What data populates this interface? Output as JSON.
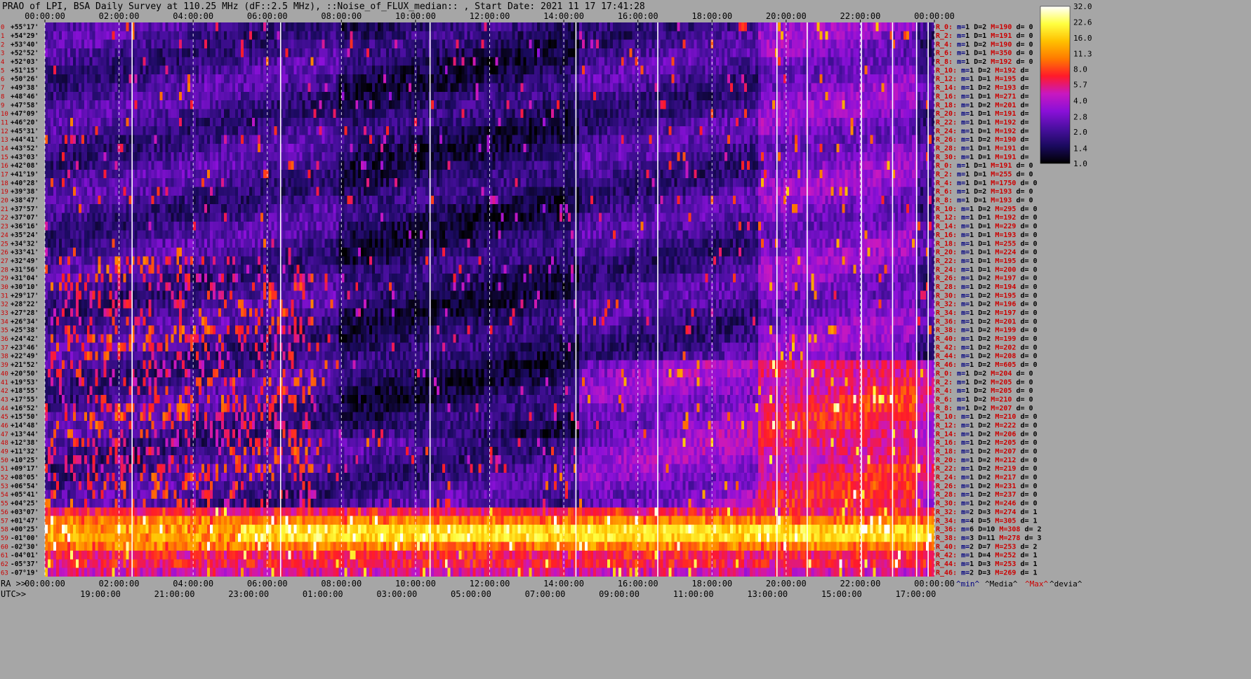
{
  "chart_data": {
    "type": "heatmap",
    "title": "PRAO of LPI, BSA Daily Survey at 110.25 MHz (dF::2.5 MHz), ::Noise_of_FLUX_median:: , Start Date: 2021 11 17 17:41:28",
    "top_ticks": [
      "00:00:00",
      "02:00:00",
      "04:00:00",
      "06:00:00",
      "08:00:00",
      "10:00:00",
      "12:00:00",
      "14:00:00",
      "16:00:00",
      "18:00:00",
      "20:00:00",
      "22:00:00",
      "00:00:00"
    ],
    "ra_label": "RA >>",
    "ra_ticks": [
      "00:00:00",
      "02:00:00",
      "04:00:00",
      "06:00:00",
      "08:00:00",
      "10:00:00",
      "12:00:00",
      "14:00:00",
      "16:00:00",
      "18:00:00",
      "20:00:00",
      "22:00:00",
      "00:00:00"
    ],
    "utc_label": "UTC>>",
    "utc_ticks": [
      "19:00:00",
      "21:00:00",
      "23:00:00",
      "01:00:00",
      "03:00:00",
      "05:00:00",
      "07:00:00",
      "09:00:00",
      "11:00:00",
      "13:00:00",
      "15:00:00",
      "17:00:00"
    ],
    "declinations": [
      "+55°17'",
      "+54°29'",
      "+53°40'",
      "+52°52'",
      "+52°03'",
      "+51°15'",
      "+50°26'",
      "+49°38'",
      "+48°46'",
      "+47°58'",
      "+47°09'",
      "+46°20'",
      "+45°31'",
      "+44°41'",
      "+43°52'",
      "+43°03'",
      "+42°08'",
      "+41°19'",
      "+40°28'",
      "+39°38'",
      "+38°47'",
      "+37°57'",
      "+37°07'",
      "+36°16'",
      "+35°24'",
      "+34°32'",
      "+33°41'",
      "+32°49'",
      "+31°56'",
      "+31°04'",
      "+30°10'",
      "+29°17'",
      "+28°22'",
      "+27°28'",
      "+26°34'",
      "+25°38'",
      "+24°42'",
      "+23°46'",
      "+22°49'",
      "+21°52'",
      "+20°50'",
      "+19°53'",
      "+18°55'",
      "+17°55'",
      "+16°52'",
      "+15°50'",
      "+14°48'",
      "+13°44'",
      "+12°38'",
      "+11°32'",
      "+10°25'",
      "+09°17'",
      "+08°05'",
      "+06°54'",
      "+05°41'",
      "+04°25'",
      "+03°07'",
      "+01°47'",
      "+00°25'",
      "-01°00'",
      "-02°30'",
      "-04°01'",
      "-05°37'",
      "-07°19'"
    ],
    "colorbar_ticks": [
      "32.0",
      "22.6",
      "16.0",
      "11.3",
      "8.0",
      "5.7",
      "4.0",
      "2.8",
      "2.0",
      "1.4",
      "1.0"
    ],
    "colorbar_range": [
      1.0,
      32.0
    ],
    "colorbar_scale": "log",
    "colormap": [
      "#000000",
      "#1a0a5e",
      "#4a0fa0",
      "#8a10d8",
      "#c818c0",
      "#ff1a2a",
      "#ff7a00",
      "#ffc000",
      "#ffff40",
      "#ffffff"
    ],
    "rows": [
      {
        "r": "R_0:",
        "m": "1",
        "d": "2",
        "M": "190",
        "dev": "0"
      },
      {
        "r": "R_2:",
        "m": "1",
        "d": "1",
        "M": "191",
        "dev": "0"
      },
      {
        "r": "R_4:",
        "m": "1",
        "d": "2",
        "M": "190",
        "dev": "0"
      },
      {
        "r": "R_6:",
        "m": "1",
        "d": "1",
        "M": "350",
        "dev": "0"
      },
      {
        "r": "R_8:",
        "m": "1",
        "d": "2",
        "M": "192",
        "dev": "0"
      },
      {
        "r": "R_10:",
        "m": "1",
        "d": "2",
        "M": "192",
        "dev": ""
      },
      {
        "r": "R_12:",
        "m": "1",
        "d": "1",
        "M": "195",
        "dev": ""
      },
      {
        "r": "R_14:",
        "m": "1",
        "d": "2",
        "M": "193",
        "dev": ""
      },
      {
        "r": "R_16:",
        "m": "1",
        "d": "1",
        "M": "271",
        "dev": ""
      },
      {
        "r": "R_18:",
        "m": "1",
        "d": "2",
        "M": "201",
        "dev": ""
      },
      {
        "r": "R_20:",
        "m": "1",
        "d": "1",
        "M": "191",
        "dev": ""
      },
      {
        "r": "R_22:",
        "m": "1",
        "d": "1",
        "M": "192",
        "dev": ""
      },
      {
        "r": "R_24:",
        "m": "1",
        "d": "1",
        "M": "192",
        "dev": ""
      },
      {
        "r": "R_26:",
        "m": "1",
        "d": "2",
        "M": "190",
        "dev": ""
      },
      {
        "r": "R_28:",
        "m": "1",
        "d": "1",
        "M": "191",
        "dev": ""
      },
      {
        "r": "R_30:",
        "m": "1",
        "d": "1",
        "M": "191",
        "dev": ""
      },
      {
        "r": "R_0:",
        "m": "1",
        "d": "1",
        "M": "191",
        "dev": "0"
      },
      {
        "r": "R_2:",
        "m": "1",
        "d": "1",
        "M": "255",
        "dev": "0"
      },
      {
        "r": "R_4:",
        "m": "1",
        "d": "1",
        "M": "1750",
        "dev": "0"
      },
      {
        "r": "R_6:",
        "m": "1",
        "d": "2",
        "M": "193",
        "dev": "0"
      },
      {
        "r": "R_8:",
        "m": "1",
        "d": "1",
        "M": "193",
        "dev": "0"
      },
      {
        "r": "R_10:",
        "m": "1",
        "d": "2",
        "M": "295",
        "dev": "0"
      },
      {
        "r": "R_12:",
        "m": "1",
        "d": "1",
        "M": "192",
        "dev": "0"
      },
      {
        "r": "R_14:",
        "m": "1",
        "d": "1",
        "M": "229",
        "dev": "0"
      },
      {
        "r": "R_16:",
        "m": "1",
        "d": "1",
        "M": "193",
        "dev": "0"
      },
      {
        "r": "R_18:",
        "m": "1",
        "d": "1",
        "M": "255",
        "dev": "0"
      },
      {
        "r": "R_20:",
        "m": "1",
        "d": "1",
        "M": "224",
        "dev": "0"
      },
      {
        "r": "R_22:",
        "m": "1",
        "d": "1",
        "M": "195",
        "dev": "0"
      },
      {
        "r": "R_24:",
        "m": "1",
        "d": "1",
        "M": "200",
        "dev": "0"
      },
      {
        "r": "R_26:",
        "m": "1",
        "d": "2",
        "M": "197",
        "dev": "0"
      },
      {
        "r": "R_28:",
        "m": "1",
        "d": "2",
        "M": "194",
        "dev": "0"
      },
      {
        "r": "R_30:",
        "m": "1",
        "d": "2",
        "M": "195",
        "dev": "0"
      },
      {
        "r": "R_32:",
        "m": "1",
        "d": "2",
        "M": "196",
        "dev": "0"
      },
      {
        "r": "R_34:",
        "m": "1",
        "d": "2",
        "M": "197",
        "dev": "0"
      },
      {
        "r": "R_36:",
        "m": "1",
        "d": "2",
        "M": "201",
        "dev": "0"
      },
      {
        "r": "R_38:",
        "m": "1",
        "d": "2",
        "M": "199",
        "dev": "0"
      },
      {
        "r": "R_40:",
        "m": "1",
        "d": "2",
        "M": "199",
        "dev": "0"
      },
      {
        "r": "R_42:",
        "m": "1",
        "d": "2",
        "M": "202",
        "dev": "0"
      },
      {
        "r": "R_44:",
        "m": "1",
        "d": "2",
        "M": "208",
        "dev": "0"
      },
      {
        "r": "R_46:",
        "m": "1",
        "d": "2",
        "M": "605",
        "dev": "0"
      },
      {
        "r": "R_0:",
        "m": "1",
        "d": "2",
        "M": "204",
        "dev": "0"
      },
      {
        "r": "R_2:",
        "m": "1",
        "d": "2",
        "M": "205",
        "dev": "0"
      },
      {
        "r": "R_4:",
        "m": "1",
        "d": "2",
        "M": "205",
        "dev": "0"
      },
      {
        "r": "R_6:",
        "m": "1",
        "d": "2",
        "M": "210",
        "dev": "0"
      },
      {
        "r": "R_8:",
        "m": "1",
        "d": "2",
        "M": "207",
        "dev": "0"
      },
      {
        "r": "R_10:",
        "m": "1",
        "d": "2",
        "M": "210",
        "dev": "0"
      },
      {
        "r": "R_12:",
        "m": "1",
        "d": "2",
        "M": "222",
        "dev": "0"
      },
      {
        "r": "R_14:",
        "m": "1",
        "d": "2",
        "M": "206",
        "dev": "0"
      },
      {
        "r": "R_16:",
        "m": "1",
        "d": "2",
        "M": "205",
        "dev": "0"
      },
      {
        "r": "R_18:",
        "m": "1",
        "d": "2",
        "M": "207",
        "dev": "0"
      },
      {
        "r": "R_20:",
        "m": "1",
        "d": "2",
        "M": "212",
        "dev": "0"
      },
      {
        "r": "R_22:",
        "m": "1",
        "d": "2",
        "M": "219",
        "dev": "0"
      },
      {
        "r": "R_24:",
        "m": "1",
        "d": "2",
        "M": "217",
        "dev": "0"
      },
      {
        "r": "R_26:",
        "m": "1",
        "d": "2",
        "M": "231",
        "dev": "0"
      },
      {
        "r": "R_28:",
        "m": "1",
        "d": "2",
        "M": "237",
        "dev": "0"
      },
      {
        "r": "R_30:",
        "m": "1",
        "d": "2",
        "M": "246",
        "dev": "0"
      },
      {
        "r": "R_32:",
        "m": "2",
        "d": "3",
        "M": "274",
        "dev": "1"
      },
      {
        "r": "R_34:",
        "m": "4",
        "d": "5",
        "M": "305",
        "dev": "1"
      },
      {
        "r": "R_36:",
        "m": "6",
        "d": "10",
        "M": "308",
        "dev": "2"
      },
      {
        "r": "R_38:",
        "m": "3",
        "d": "11",
        "M": "278",
        "dev": "3"
      },
      {
        "r": "R_40:",
        "m": "2",
        "d": "7",
        "M": "253",
        "dev": "2"
      },
      {
        "r": "R_42:",
        "m": "1",
        "d": "4",
        "M": "252",
        "dev": "1"
      },
      {
        "r": "R_44:",
        "m": "1",
        "d": "3",
        "M": "253",
        "dev": "1"
      },
      {
        "r": "R_46:",
        "m": "2",
        "d": "3",
        "M": "269",
        "dev": "1"
      }
    ],
    "footer_labels": {
      "min": "^min^",
      "media": "^Media^",
      "max": "^Max^",
      "devia": "^devia^"
    }
  },
  "colors": {
    "background": "#a6a6a6",
    "row_label": "#cc0000",
    "index_label": "#cc0000",
    "text": "#000000",
    "media_col": "#000080",
    "max_col": "#cc0000"
  }
}
